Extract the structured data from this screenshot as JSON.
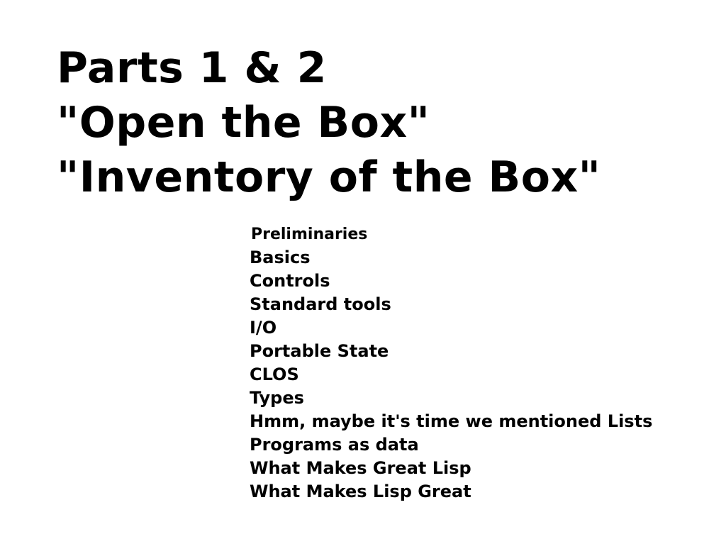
{
  "slide": {
    "title_lines": [
      "Parts 1 & 2",
      "\"Open the Box\"",
      "\"Inventory of the Box\""
    ],
    "topics": [
      "Preliminaries",
      "Basics",
      "Controls",
      "Standard tools",
      "I/O",
      "Portable State",
      "CLOS",
      "Types",
      "Hmm, maybe it's time we mentioned Lists",
      "Programs as data",
      "What Makes Great Lisp",
      "What Makes Lisp Great"
    ]
  },
  "colors": {
    "background": "#ffffff",
    "text": "#000000"
  }
}
